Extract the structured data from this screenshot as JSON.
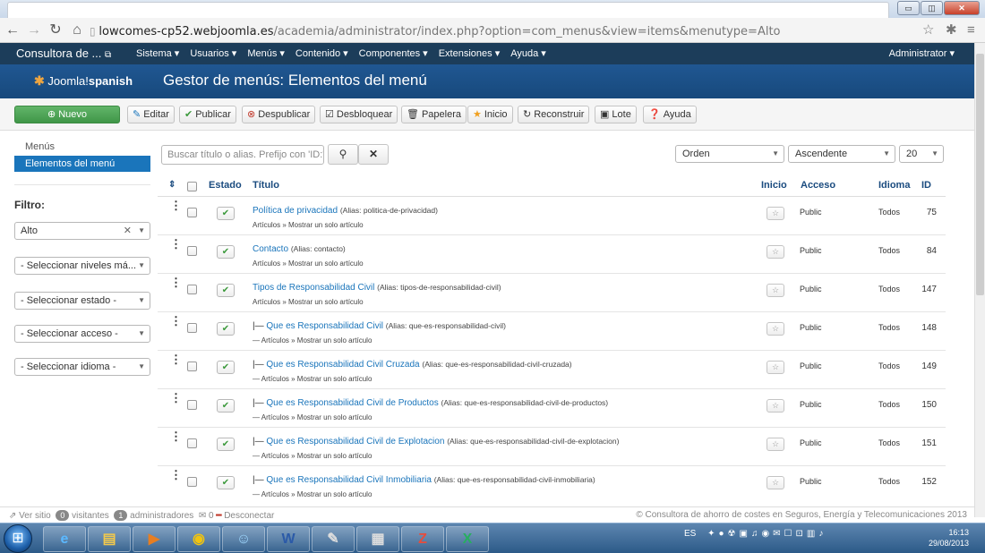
{
  "browser": {
    "url_host": "lowcomes-cp52.webjoomla.es",
    "url_path": "/academia/administrator/index.php?option=com_menus&view=items&menutype=Alto",
    "win_min": "▭",
    "win_max": "◫",
    "win_close": "✕"
  },
  "topbar": {
    "site_name": "Consultora de ...",
    "site_link_icon": "external-link-icon",
    "menus": [
      "Sistema ▾",
      "Usuarios ▾",
      "Menús ▾",
      "Contenido ▾",
      "Componentes ▾",
      "Extensiones ▾",
      "Ayuda ▾"
    ],
    "admin": "Administrator ▾"
  },
  "header": {
    "logo_prefix": "Joomla!",
    "logo_suffix": "spanish",
    "title": "Gestor de menús: Elementos del menú"
  },
  "toolbar": {
    "nuevo": "Nuevo",
    "editar": "Editar",
    "publicar": "Publicar",
    "despublicar": "Despublicar",
    "desbloquear": "Desbloquear",
    "papelera": "Papelera",
    "inicio": "Inicio",
    "reconstruir": "Reconstruir",
    "lote": "Lote",
    "ayuda": "Ayuda"
  },
  "sidebar": {
    "menus": "Menús",
    "active": "Elementos del menú",
    "filter_title": "Filtro:",
    "filter_menu": "Alto",
    "filter_levels": "- Seleccionar niveles má...",
    "filter_state": "- Seleccionar estado -",
    "filter_access": "- Seleccionar acceso -",
    "filter_lang": "- Seleccionar idioma -"
  },
  "search": {
    "placeholder": "Buscar título o alias. Prefijo con 'ID:'",
    "order": "Orden",
    "direction": "Ascendente",
    "limit": "20"
  },
  "columns": {
    "estado": "Estado",
    "titulo": "Título",
    "inicio": "Inicio",
    "acceso": "Acceso",
    "idioma": "Idioma",
    "id": "ID"
  },
  "rows": [
    {
      "prefix": "",
      "title": "Política de privacidad",
      "alias": "(Alias: politica-de-privacidad)",
      "sub": "Artículos » Mostrar un solo artículo",
      "access": "Public",
      "lang": "Todos",
      "id": "75"
    },
    {
      "prefix": "",
      "title": "Contacto",
      "alias": "(Alias: contacto)",
      "sub": "Artículos » Mostrar un solo artículo",
      "access": "Public",
      "lang": "Todos",
      "id": "84"
    },
    {
      "prefix": "",
      "title": "Tipos de Responsabilidad Civil",
      "alias": "(Alias: tipos-de-responsabilidad-civil)",
      "sub": "Artículos » Mostrar un solo artículo",
      "access": "Public",
      "lang": "Todos",
      "id": "147"
    },
    {
      "prefix": "|— ",
      "title": "Que es Responsabilidad Civil",
      "alias": "(Alias: que-es-responsabilidad-civil)",
      "sub": "— Artículos » Mostrar un solo artículo",
      "access": "Public",
      "lang": "Todos",
      "id": "148"
    },
    {
      "prefix": "|— ",
      "title": "Que es Responsabilidad Civil Cruzada",
      "alias": "(Alias: que-es-responsabilidad-civil-cruzada)",
      "sub": "— Artículos » Mostrar un solo artículo",
      "access": "Public",
      "lang": "Todos",
      "id": "149"
    },
    {
      "prefix": "|— ",
      "title": "Que es Responsabilidad Civil de Productos",
      "alias": "(Alias: que-es-responsabilidad-civil-de-productos)",
      "sub": "— Artículos » Mostrar un solo artículo",
      "access": "Public",
      "lang": "Todos",
      "id": "150"
    },
    {
      "prefix": "|— ",
      "title": "Que es Responsabilidad Civil de Explotacion",
      "alias": "(Alias: que-es-responsabilidad-civil-de-explotacion)",
      "sub": "— Artículos » Mostrar un solo artículo",
      "access": "Public",
      "lang": "Todos",
      "id": "151"
    },
    {
      "prefix": "|— ",
      "title": "Que es Responsabilidad Civil Inmobiliaria",
      "alias": "(Alias: que-es-responsabilidad-civil-inmobiliaria)",
      "sub": "— Artículos » Mostrar un solo artículo",
      "access": "Public",
      "lang": "Todos",
      "id": "152"
    }
  ],
  "footer": {
    "ver_sitio": "Ver sitio",
    "visitantes_count": "0",
    "visitantes": "visitantes",
    "admins_count": "1",
    "admins": "administradores",
    "mail_count": "0",
    "desconectar": "Desconectar",
    "copyright": "© Consultora de ahorro de costes en Seguros, Energía y Telecomunicaciones 2013"
  },
  "taskbar": {
    "lang": "ES",
    "time": "16:13",
    "date": "29/08/2013"
  },
  "colors": {
    "header_blue": "#1a4b7f",
    "topbar_navy": "#1c3d5a",
    "link_blue": "#1a75bb",
    "nuevo_green": "#4aa552"
  }
}
